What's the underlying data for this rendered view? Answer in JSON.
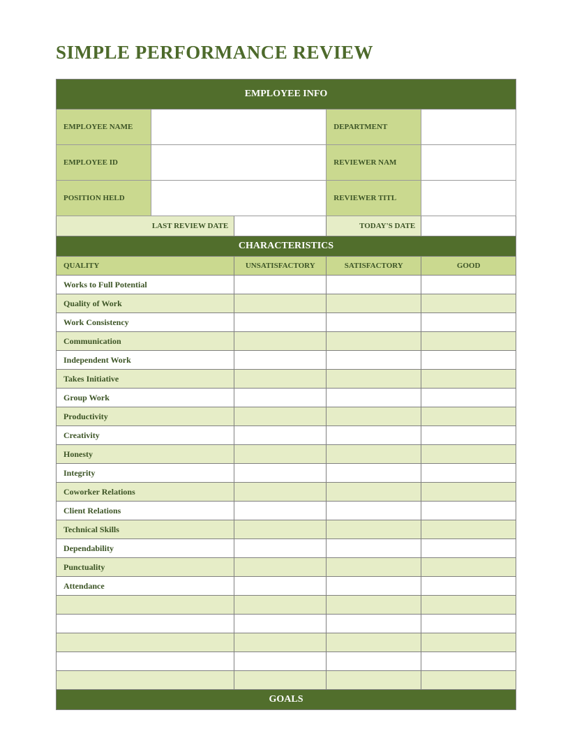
{
  "title": "SIMPLE PERFORMANCE REVIEW",
  "sections": {
    "employee_info_header": "EMPLOYEE INFO",
    "characteristics_header": "CHARACTERISTICS",
    "goals_header": "GOALS"
  },
  "employee_info": {
    "labels": {
      "employee_name": "EMPLOYEE NAME",
      "department": "DEPARTMENT",
      "employee_id": "EMPLOYEE ID",
      "reviewer_name": "REVIEWER NAM",
      "position_held": "POSITION HELD",
      "reviewer_title": "REVIEWER TITL",
      "last_review_date": "LAST REVIEW DATE",
      "todays_date": "TODAY'S DATE"
    },
    "fields": {
      "employee_name": "",
      "department": "",
      "employee_id": "",
      "reviewer_name": "",
      "position_held": "",
      "reviewer_title": "",
      "last_review_date": "",
      "todays_date": ""
    }
  },
  "characteristics": {
    "columns": {
      "quality": "QUALITY",
      "unsatisfactory": "UNSATISFACTORY",
      "satisfactory": "SATISFACTORY",
      "good": "GOOD"
    },
    "items": [
      "Works to Full Potential",
      "Quality of Work",
      "Work Consistency",
      "Communication",
      "Independent Work",
      "Takes Initiative",
      "Group Work",
      "Productivity",
      "Creativity",
      "Honesty",
      "Integrity",
      "Coworker Relations",
      "Client Relations",
      "Technical Skills",
      "Dependability",
      "Punctuality",
      "Attendance",
      "",
      "",
      "",
      "",
      ""
    ]
  }
}
